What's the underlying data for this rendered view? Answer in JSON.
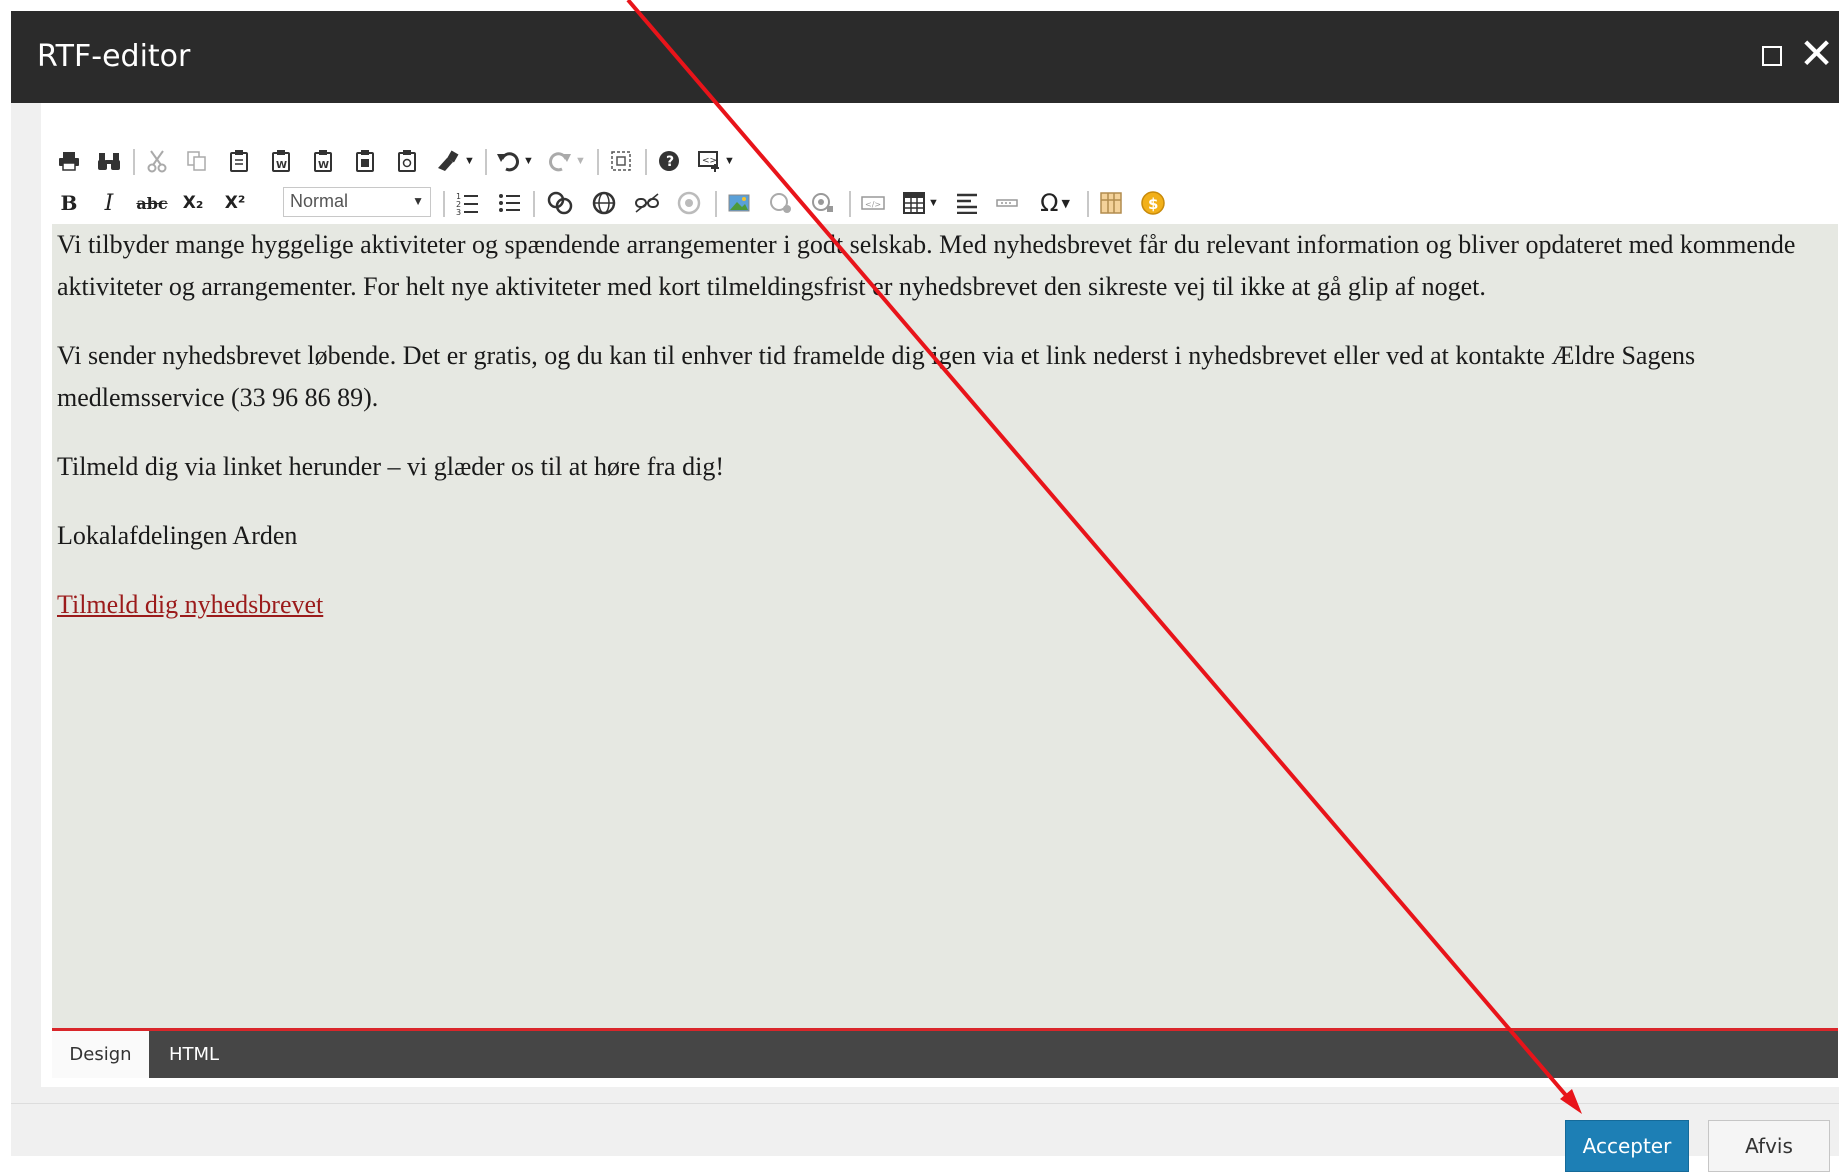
{
  "window": {
    "title": "RTF-editor",
    "maximize_icon": "maximize-icon",
    "close_icon": "close-icon"
  },
  "toolbar": {
    "row1": [
      "print-icon",
      "find-icon",
      "cut-icon",
      "copy-icon",
      "paste-icon",
      "paste-word-icon",
      "paste-word-icon",
      "paste-text-icon",
      "paste-html-icon",
      "format-painter-icon",
      "undo-icon",
      "redo-icon",
      "fullscreen-icon",
      "help-icon",
      "insert-snippet-icon"
    ],
    "row2_format_select": "Normal",
    "bold": "B",
    "italic": "I",
    "strikethrough": "abc",
    "subscript": "X₂",
    "superscript": "X²",
    "special_char": "Ω"
  },
  "content": {
    "paragraphs": [
      "Vi tilbyder mange hyggelige aktiviteter og spændende arrangementer i godt selskab. Med nyhedsbrevet får du relevant information og bliver opdateret med kommende aktiviteter og arrangementer. For helt nye aktiviteter med kort tilmeldingsfrist er nyhedsbrevet den sikreste vej til ikke at gå glip af noget.",
      "Vi sender nyhedsbrevet løbende. Det er gratis, og du kan til enhver tid framelde dig igen via et link nederst i nyhedsbrevet eller ved at kontakte Ældre Sagens medlemsservice (33 96 86 89).",
      "Tilmeld dig via linket herunder – vi glæder os til at høre fra dig!",
      "Lokalafdelingen Arden"
    ],
    "link": "Tilmeld dig nyhedsbrevet"
  },
  "mode_tabs": {
    "design": "Design",
    "html": "HTML"
  },
  "footer": {
    "accept": "Accepter",
    "reject": "Afvis"
  },
  "colors": {
    "titlebar": "#2b2b2b",
    "content_bg": "#e6e8e2",
    "link": "#9b1b1b",
    "accept_button": "#1d7fb5",
    "annotation_arrow": "#e8141a"
  }
}
